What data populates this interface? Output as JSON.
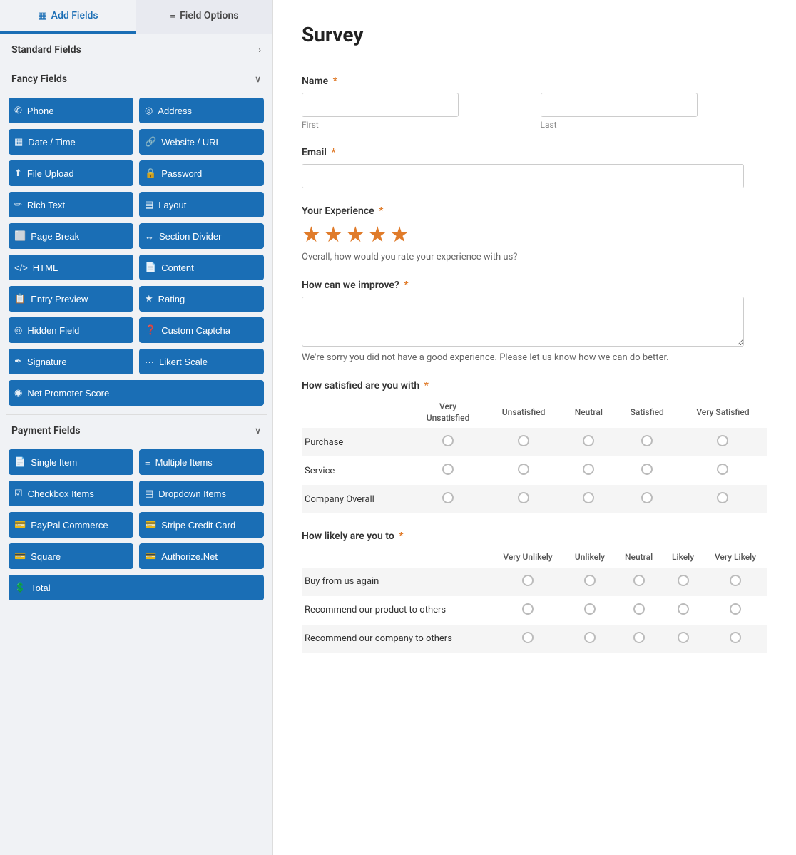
{
  "tabs": [
    {
      "id": "add-fields",
      "label": "Add Fields",
      "icon": "▦",
      "active": true
    },
    {
      "id": "field-options",
      "label": "Field Options",
      "icon": "≡",
      "active": false
    }
  ],
  "sections": {
    "standard_fields": {
      "label": "Standard Fields",
      "collapsed": false
    },
    "fancy_fields": {
      "label": "Fancy Fields",
      "collapsed": false,
      "buttons": [
        {
          "id": "phone",
          "label": "Phone",
          "icon": "📞"
        },
        {
          "id": "address",
          "label": "Address",
          "icon": "📍"
        },
        {
          "id": "datetime",
          "label": "Date / Time",
          "icon": "📅"
        },
        {
          "id": "website",
          "label": "Website / URL",
          "icon": "🔗"
        },
        {
          "id": "file-upload",
          "label": "File Upload",
          "icon": "⬆"
        },
        {
          "id": "password",
          "label": "Password",
          "icon": "🔒"
        },
        {
          "id": "rich-text",
          "label": "Rich Text",
          "icon": "✏"
        },
        {
          "id": "layout",
          "label": "Layout",
          "icon": "▤"
        },
        {
          "id": "page-break",
          "label": "Page Break",
          "icon": "⬜"
        },
        {
          "id": "section-divider",
          "label": "Section Divider",
          "icon": "↔"
        },
        {
          "id": "html",
          "label": "HTML",
          "icon": "<>"
        },
        {
          "id": "content",
          "label": "Content",
          "icon": "📄"
        },
        {
          "id": "entry-preview",
          "label": "Entry Preview",
          "icon": "📋"
        },
        {
          "id": "rating",
          "label": "Rating",
          "icon": "★"
        },
        {
          "id": "hidden-field",
          "label": "Hidden Field",
          "icon": "👁"
        },
        {
          "id": "custom-captcha",
          "label": "Custom Captcha",
          "icon": "❓"
        },
        {
          "id": "signature",
          "label": "Signature",
          "icon": "✒"
        },
        {
          "id": "likert-scale",
          "label": "Likert Scale",
          "icon": "···"
        },
        {
          "id": "net-promoter",
          "label": "Net Promoter Score",
          "icon": "◉",
          "wide": true
        }
      ]
    },
    "payment_fields": {
      "label": "Payment Fields",
      "collapsed": false,
      "buttons": [
        {
          "id": "single-item",
          "label": "Single Item",
          "icon": "📄"
        },
        {
          "id": "multiple-items",
          "label": "Multiple Items",
          "icon": "≡"
        },
        {
          "id": "checkbox-items",
          "label": "Checkbox Items",
          "icon": "☑"
        },
        {
          "id": "dropdown-items",
          "label": "Dropdown Items",
          "icon": "▤"
        },
        {
          "id": "paypal",
          "label": "PayPal Commerce",
          "icon": "💳"
        },
        {
          "id": "stripe",
          "label": "Stripe Credit Card",
          "icon": "💳"
        },
        {
          "id": "square",
          "label": "Square",
          "icon": "💳"
        },
        {
          "id": "authorize",
          "label": "Authorize.Net",
          "icon": "💳"
        },
        {
          "id": "total",
          "label": "Total",
          "icon": "💲",
          "wide": true
        }
      ]
    }
  },
  "form": {
    "title": "Survey",
    "fields": {
      "name": {
        "label": "Name",
        "required": true,
        "first_placeholder": "",
        "last_placeholder": "",
        "first_sub": "First",
        "last_sub": "Last"
      },
      "email": {
        "label": "Email",
        "required": true
      },
      "experience": {
        "label": "Your Experience",
        "required": true,
        "stars": 5,
        "hint": "Overall, how would you rate your experience with us?"
      },
      "improve": {
        "label": "How can we improve?",
        "required": true,
        "hint": "We're sorry you did not have a good experience. Please let us know how we can do better."
      },
      "satisfied": {
        "label": "How satisfied are you with",
        "required": true,
        "columns": [
          "Very Unsatisfied",
          "Unsatisfied",
          "Neutral",
          "Satisfied",
          "Very Satisfied"
        ],
        "rows": [
          "Purchase",
          "Service",
          "Company Overall"
        ]
      },
      "likely": {
        "label": "How likely are you to",
        "required": true,
        "columns": [
          "Very Unlikely",
          "Unlikely",
          "Neutral",
          "Likely",
          "Very Likely"
        ],
        "rows": [
          "Buy from us again",
          "Recommend our product to others",
          "Recommend our company to others"
        ]
      }
    }
  },
  "colors": {
    "primary_btn": "#1a6eb5",
    "required_star": "#e07b2a",
    "star_color": "#e07b2a"
  }
}
